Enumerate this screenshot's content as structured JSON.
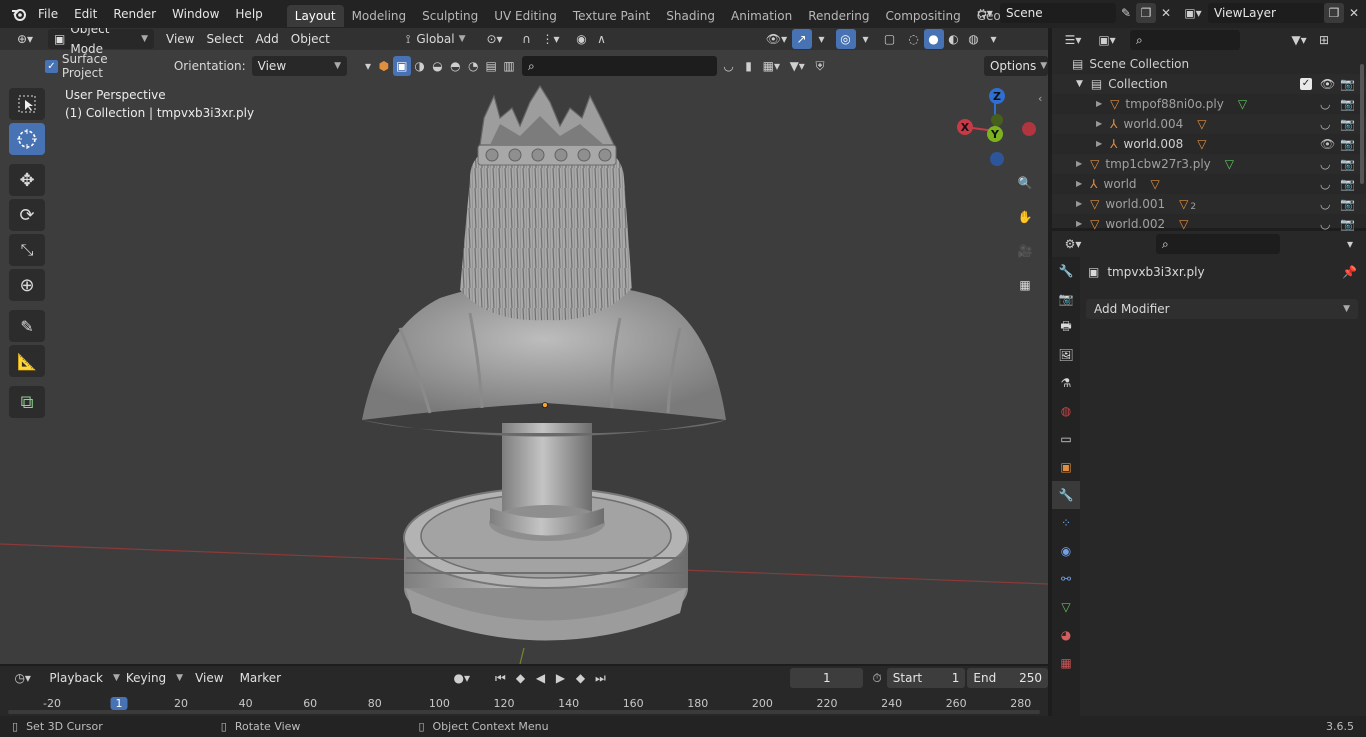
{
  "topbar": {
    "menus": [
      "File",
      "Edit",
      "Render",
      "Window",
      "Help"
    ],
    "workspaces": [
      "Layout",
      "Modeling",
      "Sculpting",
      "UV Editing",
      "Texture Paint",
      "Shading",
      "Animation",
      "Rendering",
      "Compositing",
      "Geometry Noc"
    ],
    "active_workspace": "Layout",
    "scene": "Scene",
    "view_layer": "ViewLayer"
  },
  "viewport": {
    "mode": "Object Mode",
    "menus": [
      "View",
      "Select",
      "Add",
      "Object"
    ],
    "transform_orientation": "Global",
    "surface_project_label": "Surface Project",
    "orientation_label": "Orientation:",
    "orientation_value": "View",
    "options_label": "Options",
    "overlay_line1": "User Perspective",
    "overlay_line2": "(1) Collection | tmpvxb3i3xr.ply",
    "gizmo": {
      "x": "X",
      "y": "Y",
      "z": "Z"
    }
  },
  "outliner": {
    "scene_collection": "Scene Collection",
    "collection": "Collection",
    "items": [
      {
        "name": "tmpof88ni0o.ply",
        "indent": 2,
        "dim": true
      },
      {
        "name": "world.004",
        "indent": 2,
        "dim": true
      },
      {
        "name": "world.008",
        "indent": 2,
        "dim": false
      },
      {
        "name": "tmp1cbw27r3.ply",
        "indent": 1,
        "dim": true
      },
      {
        "name": "world",
        "indent": 1,
        "dim": true
      },
      {
        "name": "world.001",
        "indent": 1,
        "dim": true,
        "badge": "2"
      },
      {
        "name": "world.002",
        "indent": 1,
        "dim": true
      }
    ]
  },
  "properties": {
    "object_name": "tmpvxb3i3xr.ply",
    "add_modifier": "Add Modifier"
  },
  "timeline": {
    "menus": [
      "Playback",
      "Keying",
      "View",
      "Marker"
    ],
    "current_frame": "1",
    "start_label": "Start",
    "start_value": "1",
    "end_label": "End",
    "end_value": "250",
    "ruler": [
      "-20",
      "1",
      "20",
      "40",
      "60",
      "80",
      "100",
      "120",
      "140",
      "160",
      "180",
      "200",
      "220",
      "240",
      "260",
      "280"
    ]
  },
  "statusbar": {
    "left": "Set 3D Cursor",
    "middle": "Rotate View",
    "right": "Object Context Menu",
    "version": "3.6.5"
  }
}
